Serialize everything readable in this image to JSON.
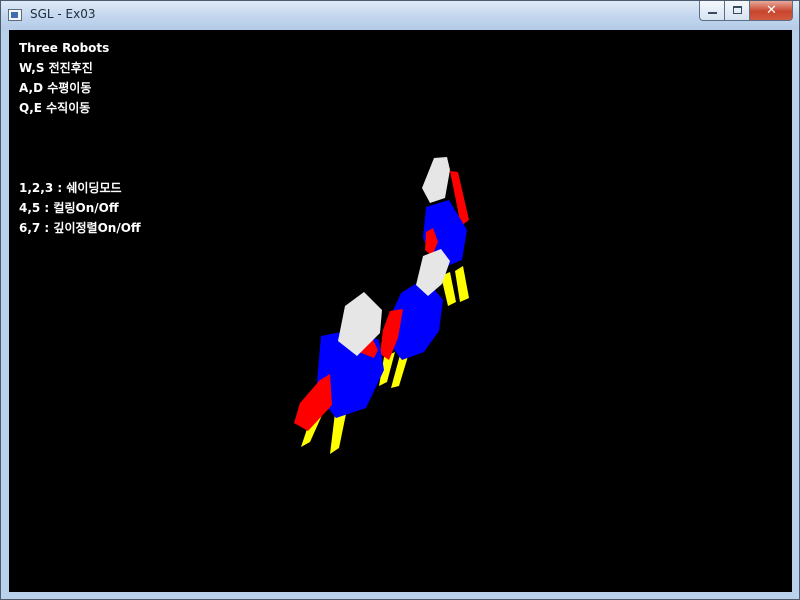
{
  "window": {
    "title": "SGL - Ex03",
    "close_glyph": "✕"
  },
  "hud": {
    "title": "Three Robots",
    "lines": [
      "W,S 전진후진",
      "A,D 수평이동",
      "Q,E 수직이동",
      "1,2,3 : 쉐이딩모드",
      "4,5 : 컬링On/Off",
      "6,7 : 깊이정렬On/Off"
    ]
  },
  "colors": {
    "viewport_bg": "#000000",
    "robot_head": "#e6e6e6",
    "robot_body": "#0000ff",
    "robot_arm": "#ff0000",
    "robot_leg": "#ffff00",
    "hud_text": "#ffffff"
  },
  "icons": {
    "app": "app-window-icon",
    "minimize": "minimize-icon",
    "maximize": "maximize-icon",
    "close": "close-icon"
  }
}
